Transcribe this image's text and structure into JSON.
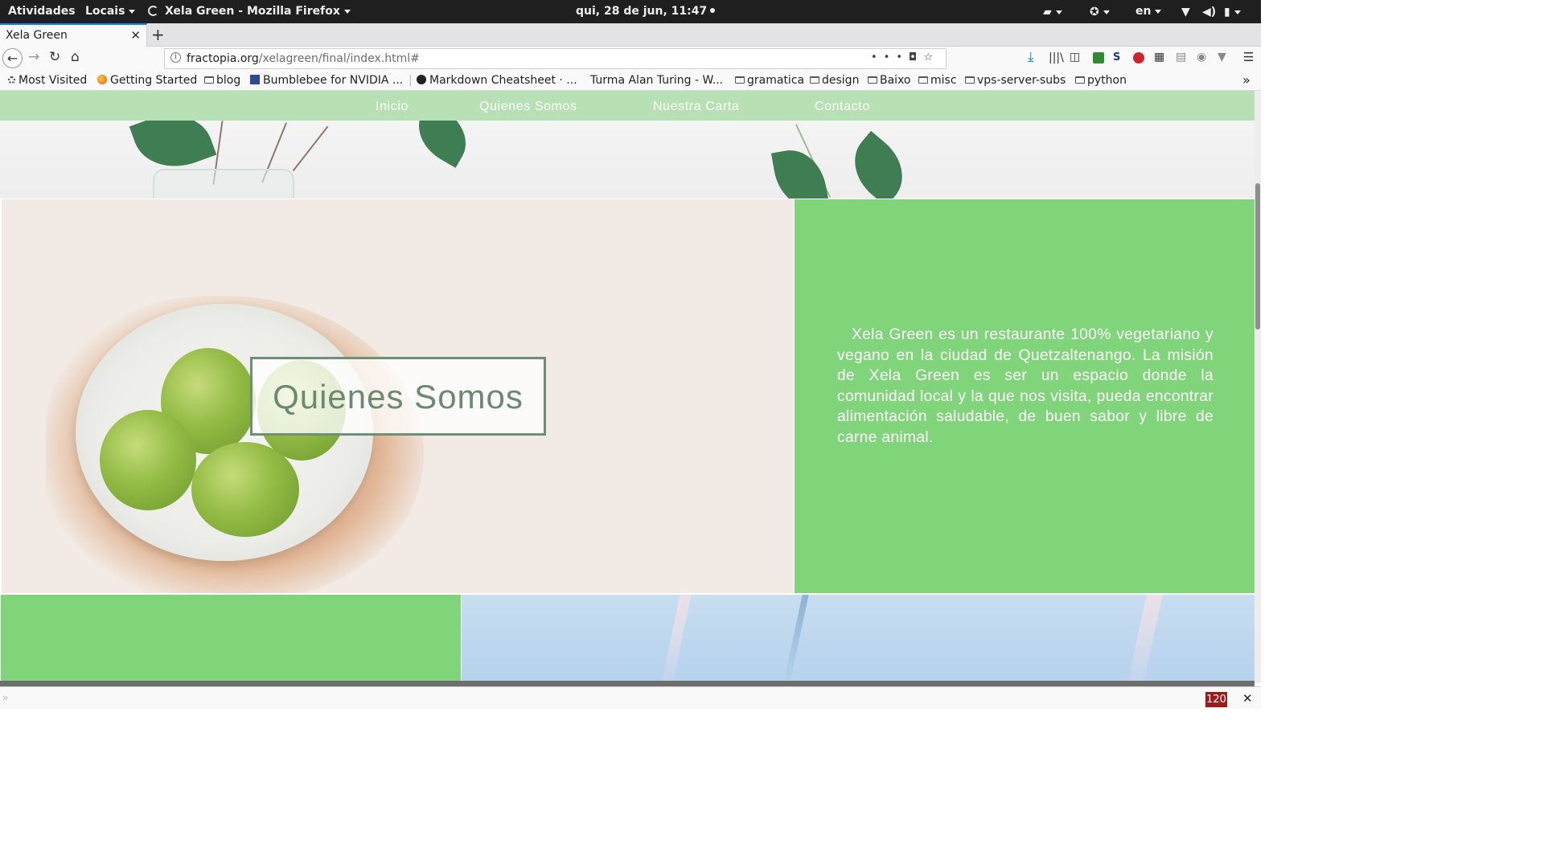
{
  "topbar": {
    "activities": "Atividades",
    "places": "Locais",
    "app_title": "Xela Green - Mozilla Firefox",
    "clock": "qui, 28 de jun, 11:47",
    "language": "en"
  },
  "browser": {
    "tab_title": "Xela Green",
    "url_domain": "fractopia.org",
    "url_path": "/xelagreen/final/index.html#",
    "bookmarks": [
      "Most Visited",
      "Getting Started",
      "blog",
      "Bumblebee for NVIDIA ...",
      "Markdown Cheatsheet · ...",
      "Turma Alan Turing - W...",
      "gramatica",
      "design",
      "Baixo",
      "misc",
      "vps-server-subs",
      "python"
    ],
    "bottom_counter": "120"
  },
  "site": {
    "nav": [
      "Inicio",
      "Quienes Somos",
      "Nuestra Carta",
      "Contacto"
    ],
    "about_heading": "Quienes Somos",
    "about_text": "Xela Green es un restaurante 100% vegetariano y vegano en la ciudad de Quetzaltenango. La misión de Xela Green es ser un espacio donde la comunidad local y la que nos visita, pueda encontrar alimentación saludable, de buen sabor y libre de carne animal."
  },
  "colors": {
    "nav_bg": "#b8e0b5",
    "green_panel": "#80d47a",
    "heading_green": "#6b8a72"
  },
  "icons": [
    "firefox-icon",
    "back-icon",
    "forward-icon",
    "reload-icon",
    "home-icon",
    "info-icon",
    "more-icon",
    "pocket-icon",
    "bookmark-star-icon",
    "download-icon",
    "library-icon",
    "sidebar-icon",
    "menu-icon",
    "wifi-icon",
    "volume-icon",
    "battery-icon",
    "accessibility-icon",
    "docker-icon"
  ]
}
